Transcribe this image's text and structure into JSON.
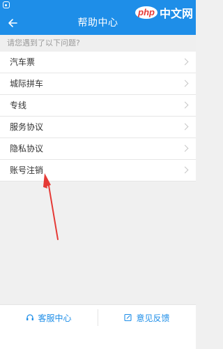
{
  "header": {
    "title": "帮助中心",
    "back_icon": "back-arrow-icon",
    "background_color": "#1e8ee8"
  },
  "watermark": {
    "badge": "php",
    "text": "中文网"
  },
  "section_hint": "请您遇到了以下问题?",
  "help_items": [
    {
      "label": "汽车票"
    },
    {
      "label": "城际拼车"
    },
    {
      "label": "专线"
    },
    {
      "label": "服务协议"
    },
    {
      "label": "隐私协议"
    },
    {
      "label": "账号注销"
    }
  ],
  "annotation": {
    "arrow_color": "#e53935",
    "points_to": "账号注销"
  },
  "bottom_bar": {
    "customer_service_label": "客服中心",
    "customer_service_icon": "headset-icon",
    "feedback_label": "意见反馈",
    "feedback_icon": "edit-icon",
    "accent_color": "#1e8ee8"
  }
}
